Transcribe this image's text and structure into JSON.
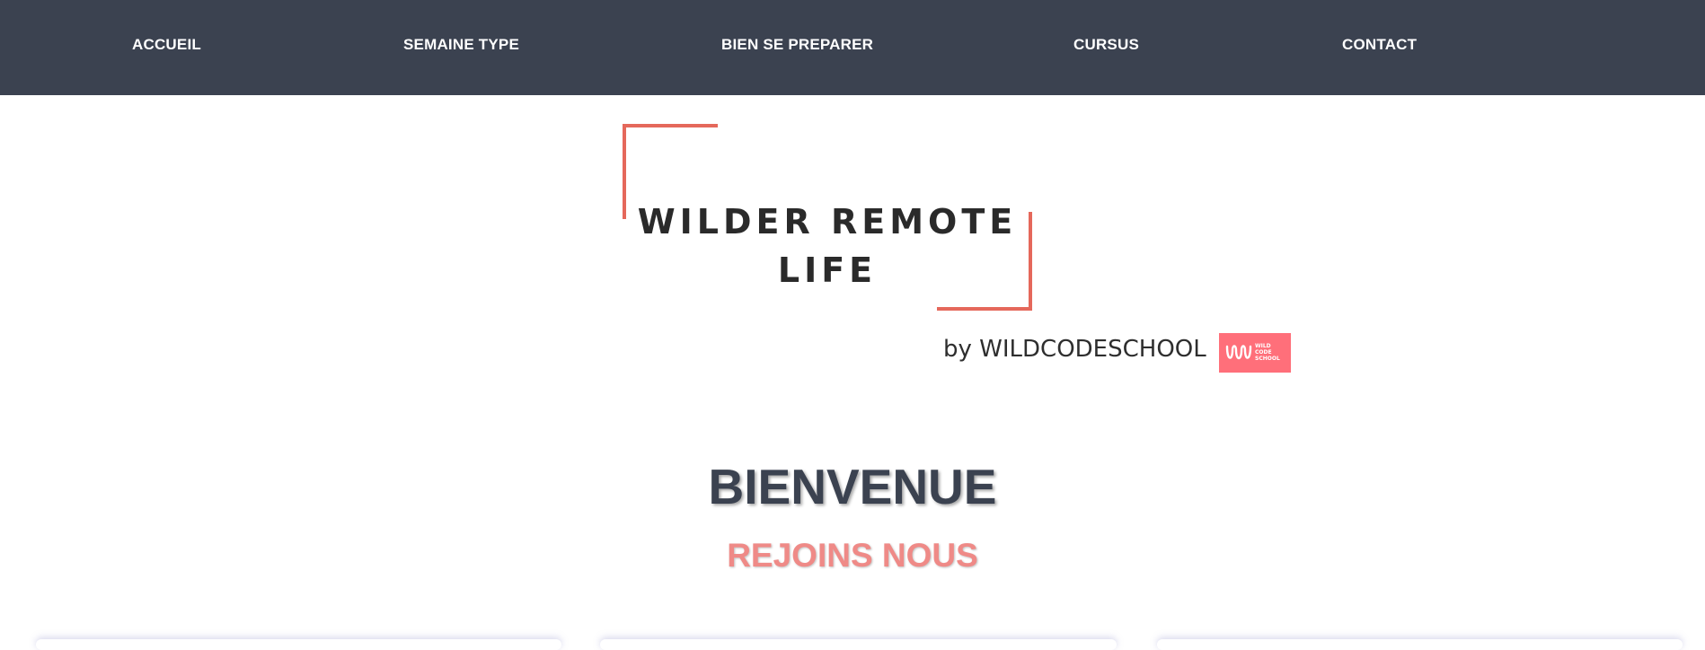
{
  "nav": {
    "items": [
      {
        "label": "ACCUEIL"
      },
      {
        "label": "SEMAINE TYPE"
      },
      {
        "label": "BIEN SE PREPARER"
      },
      {
        "label": "CURSUS"
      },
      {
        "label": "CONTACT"
      }
    ]
  },
  "logo": {
    "title_line1": "WILDER REMOTE",
    "title_line2": "LIFE",
    "byline": "by WILDCODESCHOOL",
    "badge_text": [
      "WILD",
      "CODE",
      "SCHOOL"
    ],
    "accent_color": "#e5685b",
    "badge_color": "#ff6f7a"
  },
  "hero": {
    "title": "BIENVENUE",
    "subtitle": "REJOINS NOUS"
  },
  "colors": {
    "navbar": "#3b4250",
    "title": "#3b4250",
    "subtitle": "#ef8a87"
  }
}
